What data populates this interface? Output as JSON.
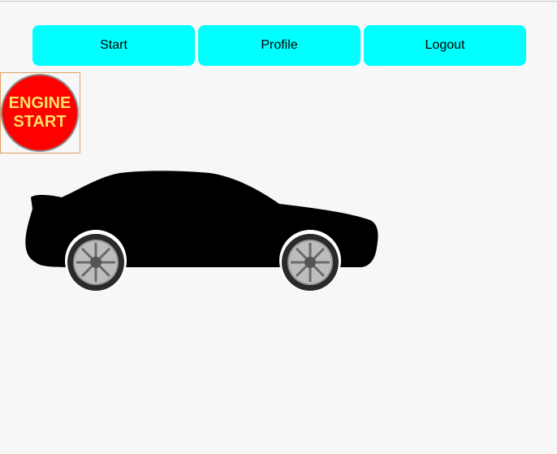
{
  "nav": {
    "start_label": "Start",
    "profile_label": "Profile",
    "logout_label": "Logout"
  },
  "engine": {
    "line1": "ENGINE",
    "line2": "START"
  },
  "colors": {
    "nav_button": "#00ffff",
    "engine_button": "#ff0000",
    "engine_text": "#ffe066",
    "car_body": "#000000"
  },
  "car": {
    "icon": "car-icon"
  }
}
